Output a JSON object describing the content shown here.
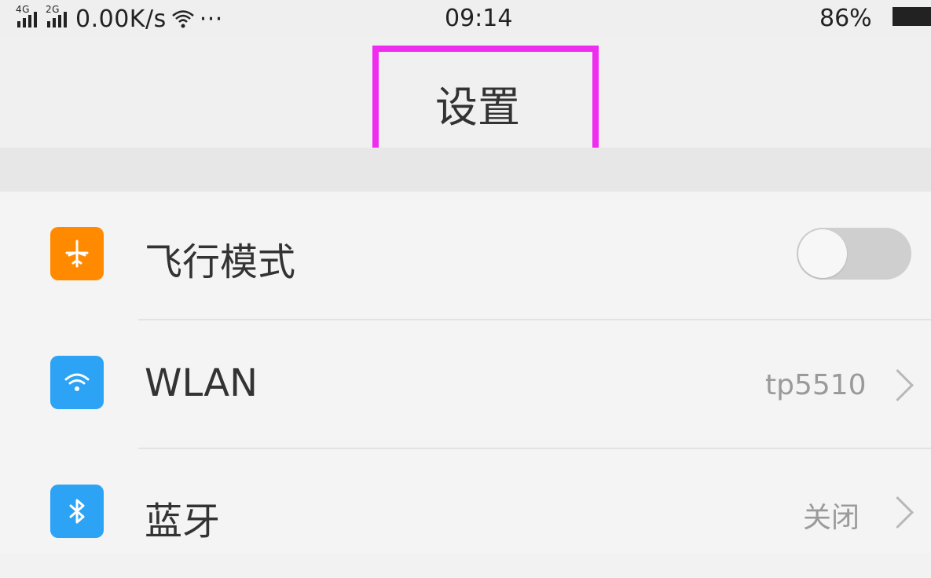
{
  "status_bar": {
    "network_1": "4G",
    "network_2": "2G",
    "speed": "0.00K/s",
    "more": "···",
    "time": "09:14",
    "battery": "86%"
  },
  "header": {
    "title": "设置"
  },
  "settings": {
    "items": [
      {
        "label": "飞行模式",
        "icon": "airplane-icon",
        "color": "#ff8a00",
        "toggle_on": false
      },
      {
        "label": "WLAN",
        "icon": "wifi-icon",
        "color": "#2da3f5",
        "value": "tp5510"
      },
      {
        "label": "蓝牙",
        "icon": "bluetooth-icon",
        "color": "#2da3f5",
        "value": "关闭"
      }
    ]
  },
  "colors": {
    "highlight": "#ef2df0"
  }
}
